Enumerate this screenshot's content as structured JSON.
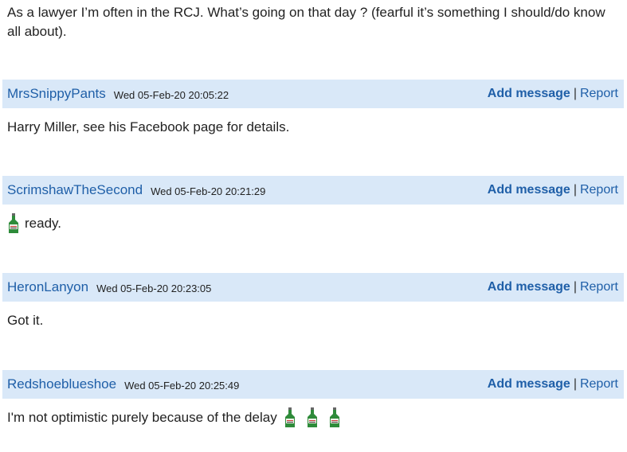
{
  "intro_text": "As a lawyer I’m often in the RCJ. What’s going on that day ? (fearful it’s something I should/do know all about).",
  "actions": {
    "add_message": "Add message",
    "separator": "|",
    "report": "Report"
  },
  "posts": [
    {
      "username": "MrsSnippyPants",
      "timestamp": "Wed 05-Feb-20 20:05:22",
      "body": "Harry Miller, see his Facebook page for details."
    },
    {
      "username": "ScrimshawTheSecond",
      "timestamp": "Wed 05-Feb-20 20:21:29",
      "icon": "gin-bottle-icon",
      "body": "ready."
    },
    {
      "username": "HeronLanyon",
      "timestamp": "Wed 05-Feb-20 20:23:05",
      "body": "Got it."
    },
    {
      "username": "Redshoeblueshoe",
      "timestamp": "Wed 05-Feb-20 20:25:49",
      "body": "I'm not optimistic purely because of the delay",
      "trailing_icons": [
        "gin-bottle-icon",
        "gin-bottle-icon",
        "gin-bottle-icon"
      ]
    }
  ],
  "colors": {
    "header_bg": "#d9e8f8",
    "link": "#1f5fa8",
    "bottle_green": "#2e8b3a"
  }
}
